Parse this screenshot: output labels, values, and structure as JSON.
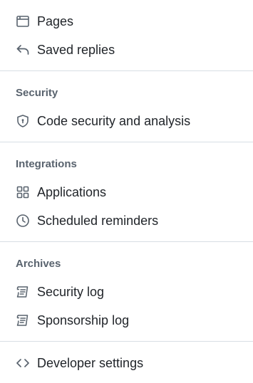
{
  "menu": {
    "pages": {
      "label": "Pages",
      "icon": "browser-icon"
    },
    "saved_replies": {
      "label": "Saved replies",
      "icon": "reply-icon"
    },
    "security": {
      "heading": "Security",
      "code_security": {
        "label": "Code security and analysis",
        "icon": "shield-lock-icon"
      }
    },
    "integrations": {
      "heading": "Integrations",
      "applications": {
        "label": "Applications",
        "icon": "apps-icon"
      },
      "scheduled_reminders": {
        "label": "Scheduled reminders",
        "icon": "clock-icon"
      }
    },
    "archives": {
      "heading": "Archives",
      "security_log": {
        "label": "Security log",
        "icon": "log-icon"
      },
      "sponsorship_log": {
        "label": "Sponsorship log",
        "icon": "log-icon"
      }
    },
    "developer_settings": {
      "label": "Developer settings",
      "icon": "code-icon"
    }
  },
  "colors": {
    "text": "#1f2328",
    "heading": "#59636e",
    "icon": "#59636e",
    "divider": "#d8dee4"
  }
}
